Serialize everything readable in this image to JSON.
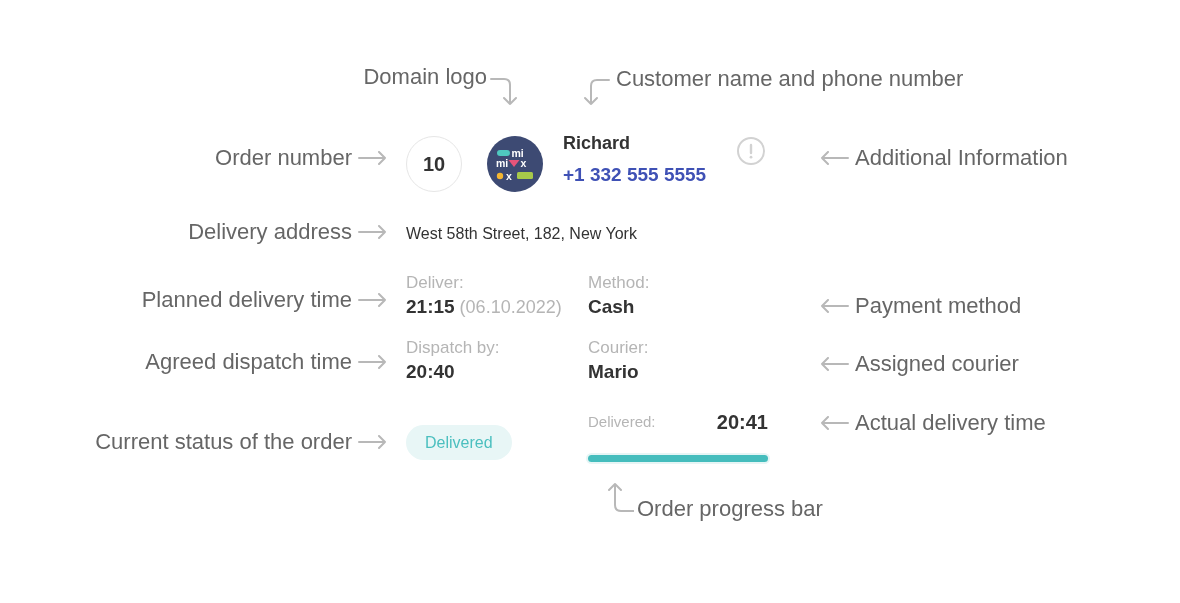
{
  "top_callouts": [
    "Domain logo",
    "Customer name and phone number"
  ],
  "order_card": {
    "order_number": "10",
    "domain_logo": {
      "letters": [
        "mi",
        "mi",
        "x",
        "x"
      ]
    },
    "customer": {
      "name": "Richard",
      "phone": "+1 332 555 5555"
    },
    "address": "West 58th Street, 182, New York",
    "deliver": {
      "label": "Deliver:",
      "time": "21:15",
      "date": "(06.10.2022)"
    },
    "method": {
      "label": "Method:",
      "value": "Cash"
    },
    "dispatch": {
      "label": "Dispatch by:",
      "value": "20:40"
    },
    "courier": {
      "label": "Courier:",
      "value": "Mario"
    },
    "status": "Delivered",
    "delivered": {
      "label": "Delivered:",
      "time": "20:41"
    },
    "progress": {
      "level": 1.0
    }
  },
  "left_callouts": [
    "Order number",
    "Delivery address",
    "Planned delivery time",
    "Agreed dispatch time",
    "Current status of the order"
  ],
  "right_callouts": [
    "Additional Information",
    "Payment method",
    "Assigned courier",
    "Actual delivery time"
  ],
  "bottom_callouts": [
    "Order progress bar"
  ]
}
